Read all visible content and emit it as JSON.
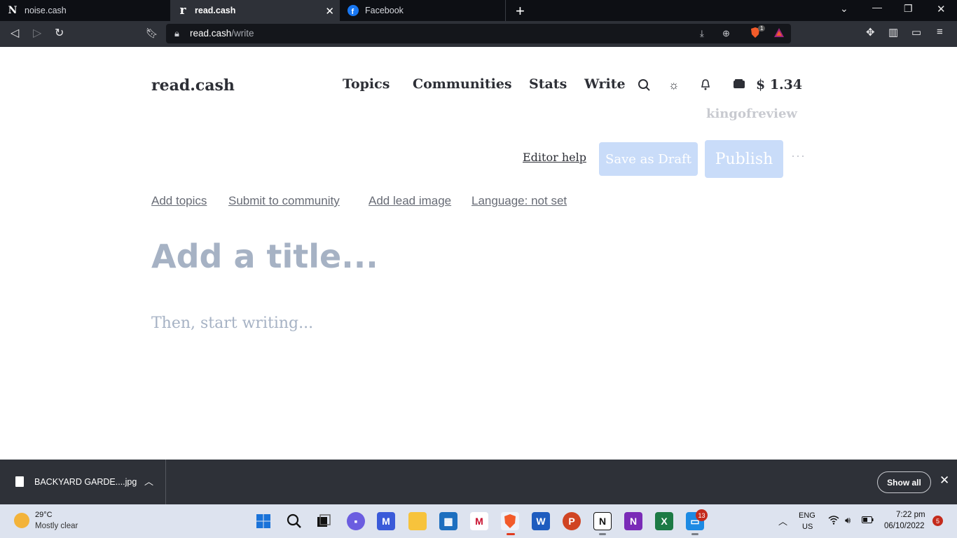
{
  "browser": {
    "tabs": [
      {
        "title": "noise.cash",
        "icon": "noise-cash-favicon"
      },
      {
        "title": "read.cash",
        "icon": "read-cash-favicon",
        "active": true
      },
      {
        "title": "Facebook",
        "icon": "facebook-favicon"
      }
    ],
    "url_host": "read.cash",
    "url_path": "/write",
    "brave_badge": "1"
  },
  "header": {
    "logo": "read.cash",
    "nav": [
      "Topics",
      "Communities",
      "Stats",
      "Write"
    ],
    "balance": "$ 1.34",
    "username": "kingofreview"
  },
  "editor": {
    "editor_help": "Editor help",
    "save_draft": "Save as Draft",
    "publish": "Publish",
    "more": "···",
    "meta_links": [
      "Add topics",
      "Submit to community",
      "Add lead image",
      "Language: not set"
    ],
    "title_placeholder": "Add a title...",
    "body_placeholder": "Then, start writing..."
  },
  "downloads": {
    "file_name": "BACKYARD GARDE....jpg",
    "show_all": "Show all"
  },
  "taskbar": {
    "weather_temp": "29°C",
    "weather_desc": "Mostly clear",
    "badge_count": "13",
    "lang_primary": "ENG",
    "lang_secondary": "US",
    "time": "7:22 pm",
    "date": "06/10/2022",
    "notifications": "5"
  }
}
